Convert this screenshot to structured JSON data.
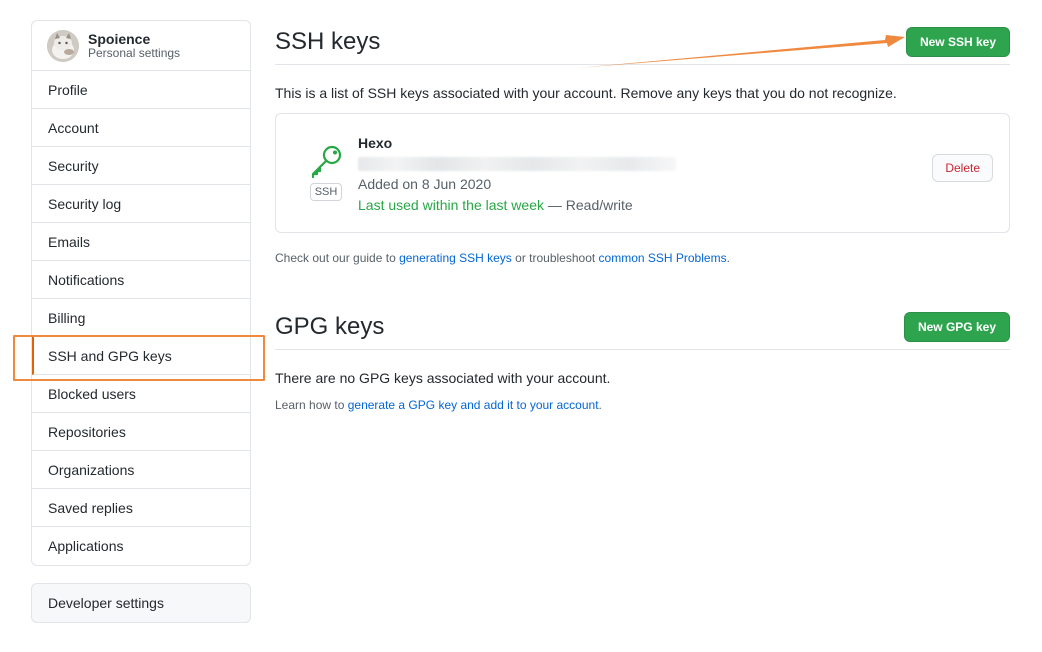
{
  "user": {
    "name": "Spoience",
    "subtitle": "Personal settings"
  },
  "sidebar": {
    "items": [
      {
        "label": "Profile"
      },
      {
        "label": "Account"
      },
      {
        "label": "Security"
      },
      {
        "label": "Security log"
      },
      {
        "label": "Emails"
      },
      {
        "label": "Notifications"
      },
      {
        "label": "Billing"
      },
      {
        "label": "SSH and GPG keys",
        "selected": true
      },
      {
        "label": "Blocked users"
      },
      {
        "label": "Repositories"
      },
      {
        "label": "Organizations"
      },
      {
        "label": "Saved replies"
      },
      {
        "label": "Applications"
      }
    ],
    "developer": "Developer settings"
  },
  "ssh": {
    "title": "SSH keys",
    "new_button": "New SSH key",
    "description": "This is a list of SSH keys associated with your account. Remove any keys that you do not recognize.",
    "key": {
      "icon": "key-icon",
      "badge": "SSH",
      "title": "Hexo",
      "added": "Added on 8 Jun 2020",
      "last_used": "Last used within the last week",
      "access": "— Read/write",
      "delete_label": "Delete"
    },
    "guide_prefix": "Check out our guide to ",
    "guide_link1": "generating SSH keys",
    "guide_middle": " or troubleshoot ",
    "guide_link2": "common SSH Problems",
    "guide_suffix": "."
  },
  "gpg": {
    "title": "GPG keys",
    "new_button": "New GPG key",
    "empty": "There are no GPG keys associated with your account.",
    "learn_prefix": "Learn how to ",
    "learn_link": "generate a GPG key and add it to your account",
    "learn_suffix": "."
  },
  "colors": {
    "accent_green": "#2ea44f",
    "annotation_orange": "#f0883e",
    "link_blue": "#0366d6",
    "danger_red": "#cb2431"
  }
}
